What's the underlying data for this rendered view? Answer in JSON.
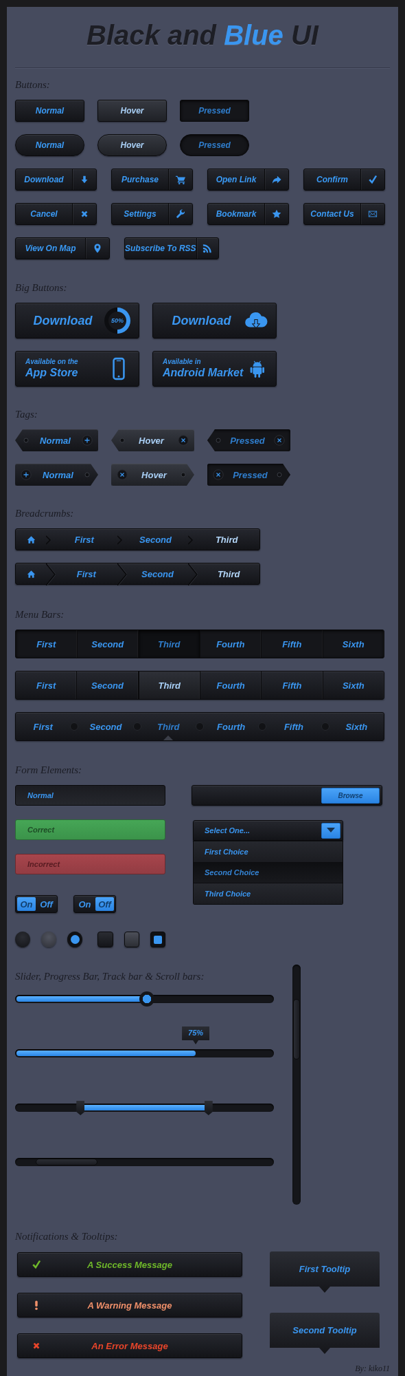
{
  "title": [
    {
      "text": "Black and",
      "kind": "dark"
    },
    {
      "text": "Blue",
      "kind": "accent"
    },
    {
      "text": "UI",
      "kind": "dark"
    }
  ],
  "buttons": {
    "heading": "Buttons:",
    "plain": [
      {
        "label": "Normal",
        "hover": false,
        "pressed": false
      },
      {
        "label": "Hover",
        "hover": true,
        "pressed": false
      },
      {
        "label": "Pressed",
        "hover": false,
        "pressed": true
      }
    ],
    "pills": [
      {
        "label": "Normal",
        "hover": false,
        "pressed": false
      },
      {
        "label": "Hover",
        "hover": true,
        "pressed": false
      },
      {
        "label": "Pressed",
        "hover": false,
        "pressed": true
      }
    ],
    "icon_button_rows": [
      [
        {
          "label": "Download"
        },
        {
          "label": "Purchase"
        },
        {
          "label": "Open Link"
        },
        {
          "label": "Confirm"
        }
      ],
      [
        {
          "label": "Cancel"
        },
        {
          "label": "Settings"
        },
        {
          "label": "Bookmark"
        },
        {
          "label": "Contact Us"
        }
      ],
      [
        {
          "label": "View On Map"
        },
        {
          "label": "Subscribe To RSS"
        }
      ]
    ]
  },
  "big_buttons": {
    "heading": "Big Buttons:",
    "items": [
      {
        "kind": "progress",
        "label": "Download",
        "reading": "50%"
      },
      {
        "kind": "icon",
        "label": "Download"
      },
      {
        "kind": "store",
        "caption": "Available on the",
        "label": "App Store"
      },
      {
        "kind": "store",
        "caption": "Available in",
        "label": "Android Market"
      }
    ]
  },
  "tags": {
    "heading": "Tags:",
    "rows": [
      {
        "kind": "left",
        "items": [
          {
            "label": "Normal",
            "hover": false,
            "pressed": false
          },
          {
            "label": "Hover",
            "hover": true,
            "pressed": false
          },
          {
            "label": "Pressed",
            "hover": false,
            "pressed": true
          }
        ]
      },
      {
        "kind": "right",
        "items": [
          {
            "label": "Normal",
            "hover": false,
            "pressed": false
          },
          {
            "label": "Hover",
            "hover": true,
            "pressed": false
          },
          {
            "label": "Pressed",
            "hover": false,
            "pressed": true
          }
        ]
      }
    ]
  },
  "breadcrumbs": {
    "heading": "Breadcrumbs:",
    "bars": [
      {
        "kind": "notch",
        "items": [
          {
            "label": "First",
            "selected": false
          },
          {
            "label": "Second",
            "selected": false
          },
          {
            "label": "Third",
            "selected": true
          }
        ]
      },
      {
        "kind": "chevron",
        "items": [
          {
            "label": "First",
            "selected": false
          },
          {
            "label": "Second",
            "selected": false
          },
          {
            "label": "Third",
            "selected": true
          }
        ]
      }
    ]
  },
  "menu_bars": {
    "heading": "Menu Bars:",
    "bars": [
      {
        "kind": "pressed",
        "items": [
          {
            "label": "First",
            "selected": false
          },
          {
            "label": "Second",
            "selected": false
          },
          {
            "label": "Third",
            "selected": true
          },
          {
            "label": "Fourth",
            "selected": false
          },
          {
            "label": "Fifth",
            "selected": false
          },
          {
            "label": "Sixth",
            "selected": false
          }
        ]
      },
      {
        "kind": "raised",
        "items": [
          {
            "label": "First",
            "selected": false
          },
          {
            "label": "Second",
            "selected": false
          },
          {
            "label": "Third",
            "selected": true
          },
          {
            "label": "Fourth",
            "selected": false
          },
          {
            "label": "Fifth",
            "selected": false
          },
          {
            "label": "Sixth",
            "selected": false
          }
        ]
      },
      {
        "kind": "dots",
        "items": [
          {
            "label": "First",
            "selected": false
          },
          {
            "label": "Second",
            "selected": false
          },
          {
            "label": "Third",
            "selected": true
          },
          {
            "label": "Fourth",
            "selected": false
          },
          {
            "label": "Fifth",
            "selected": false
          },
          {
            "label": "Sixth",
            "selected": false
          }
        ]
      }
    ]
  },
  "form": {
    "heading": "Form Elements:",
    "text_fields": [
      {
        "value": "Normal",
        "kind": "normal"
      },
      {
        "value": "Correct",
        "kind": "valid"
      },
      {
        "value": "Incorrect",
        "kind": "invalid"
      }
    ],
    "file_field": {
      "button": "Browse"
    },
    "select": {
      "value": "Select One...",
      "expanded": true,
      "options": [
        {
          "label": "First Choice",
          "selected": false
        },
        {
          "label": "Second Choice",
          "selected": true
        },
        {
          "label": "Third Choice",
          "selected": false
        }
      ]
    },
    "toggles": [
      {
        "on_label": "On",
        "off_label": "Off",
        "on": true
      },
      {
        "on_label": "On",
        "off_label": "Off",
        "on": false
      }
    ],
    "radios": [
      {
        "kind": "normal",
        "selected": false
      },
      {
        "kind": "hover",
        "selected": false
      },
      {
        "kind": "normal",
        "selected": true
      }
    ],
    "checkboxes": [
      {
        "kind": "normal",
        "checked": false
      },
      {
        "kind": "hover",
        "checked": false
      },
      {
        "kind": "normal",
        "checked": true
      }
    ]
  },
  "sliders": {
    "heading": "Slider, Progress Bar, Track bar & Scroll bars:",
    "slider": {
      "level": 0.51
    },
    "progress": {
      "level": 0.7,
      "reading": "75%"
    },
    "range": {
      "start": {
        "level": 0.25
      },
      "end": {
        "level": 0.75
      }
    }
  },
  "notifications": {
    "heading": "Notifications & Tooltips:",
    "messages": [
      {
        "kind": "success",
        "text": "A Success Message"
      },
      {
        "kind": "warning",
        "text": "A Warning Message"
      },
      {
        "kind": "error",
        "text": "An Error Message"
      }
    ],
    "tooltips": [
      {
        "text": "First Tooltip"
      },
      {
        "text": "Second Tooltip"
      }
    ]
  },
  "credit": "By: kiko11"
}
